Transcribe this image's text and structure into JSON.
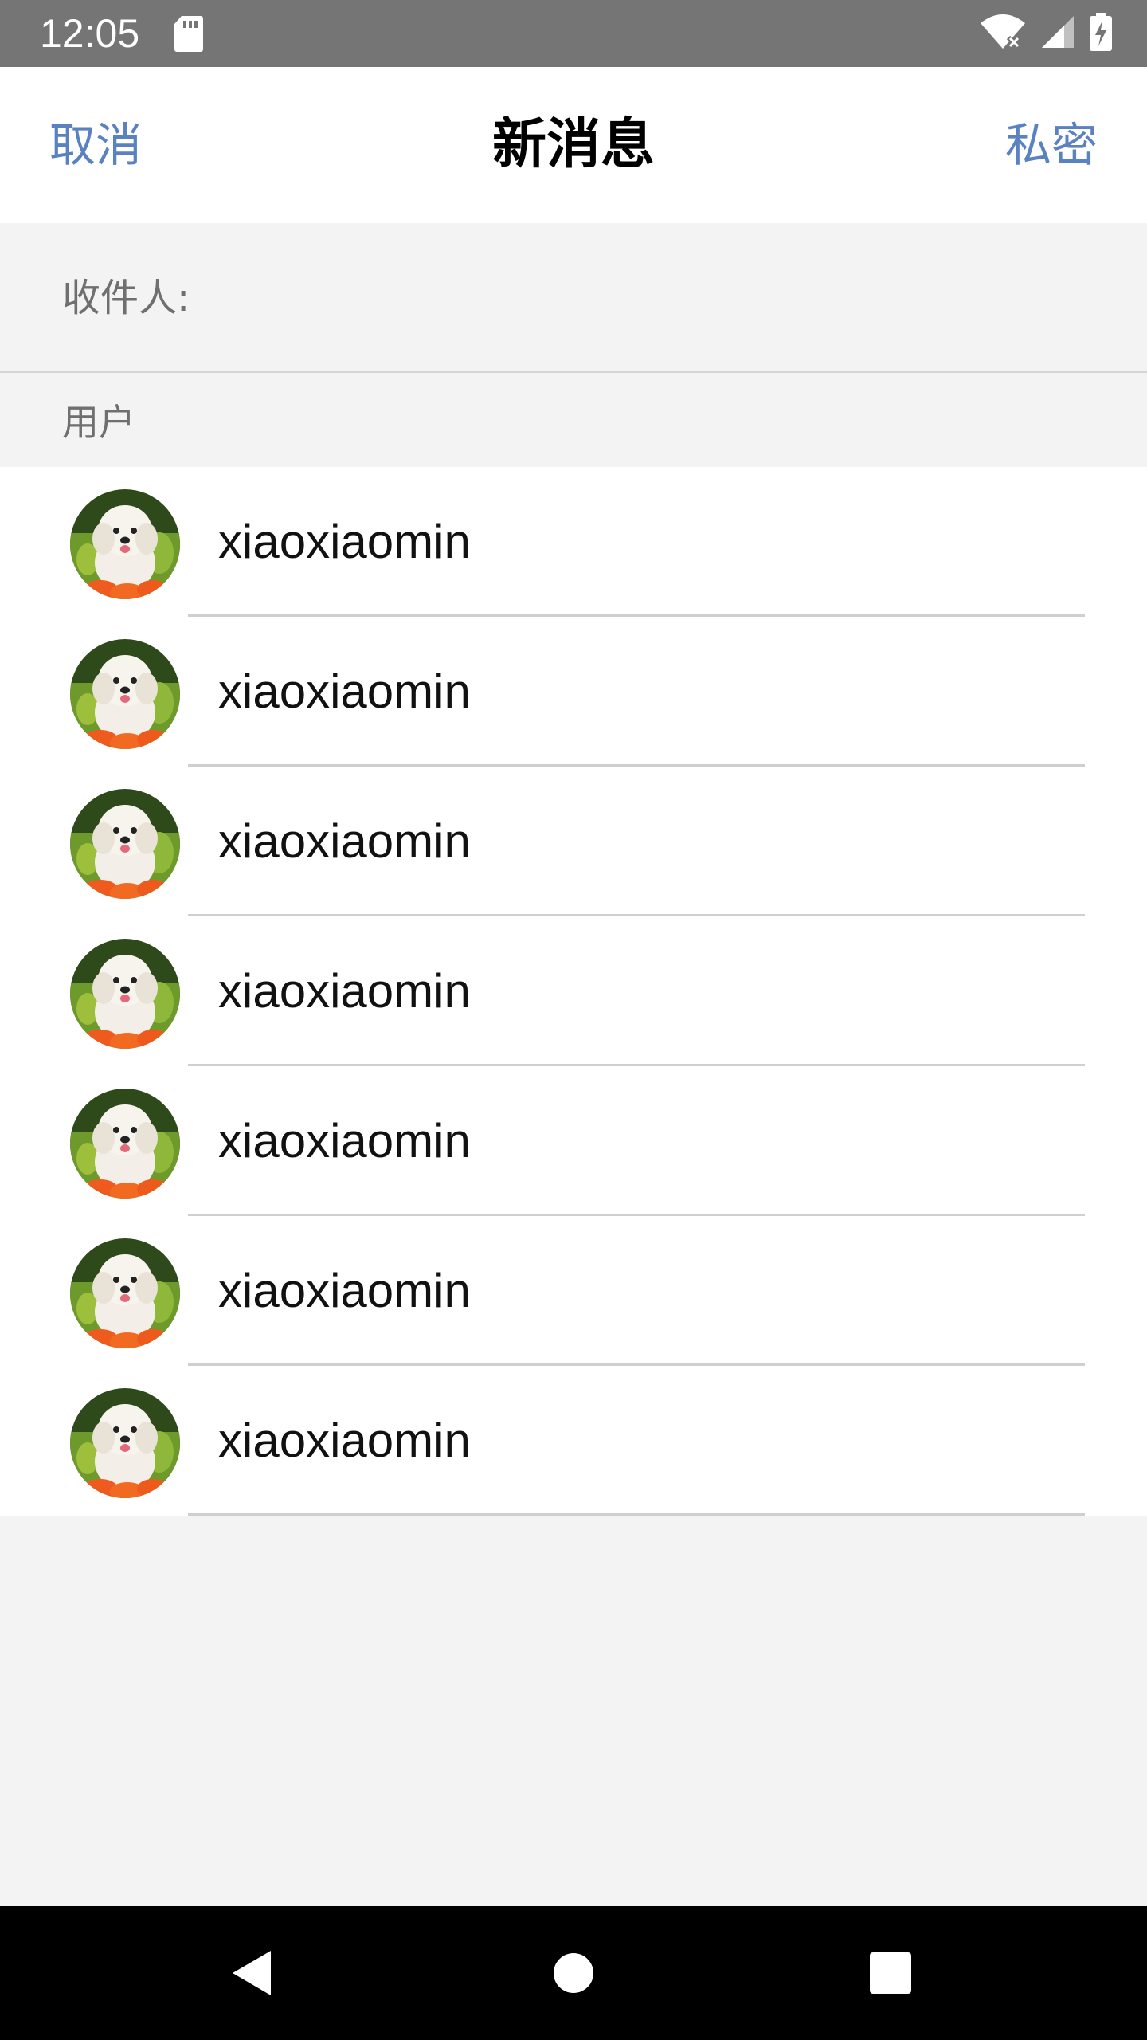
{
  "status_bar": {
    "time": "12:05",
    "icons": [
      "sd-card-icon",
      "wifi-icon",
      "signal-icon",
      "battery-charging-icon"
    ]
  },
  "header": {
    "cancel_label": "取消",
    "title": "新消息",
    "private_label": "私密"
  },
  "recipient": {
    "label": "收件人:",
    "value": ""
  },
  "section": {
    "label": "用户"
  },
  "users": [
    {
      "name": "xiaoxiaomin"
    },
    {
      "name": "xiaoxiaomin"
    },
    {
      "name": "xiaoxiaomin"
    },
    {
      "name": "xiaoxiaomin"
    },
    {
      "name": "xiaoxiaomin"
    },
    {
      "name": "xiaoxiaomin"
    },
    {
      "name": "xiaoxiaomin"
    }
  ],
  "nav_bar": {
    "icons": [
      "back-icon",
      "home-icon",
      "recents-icon"
    ]
  },
  "colors": {
    "accent": "#5a82c0",
    "status_bar": "#757575",
    "background": "#f3f3f3"
  }
}
